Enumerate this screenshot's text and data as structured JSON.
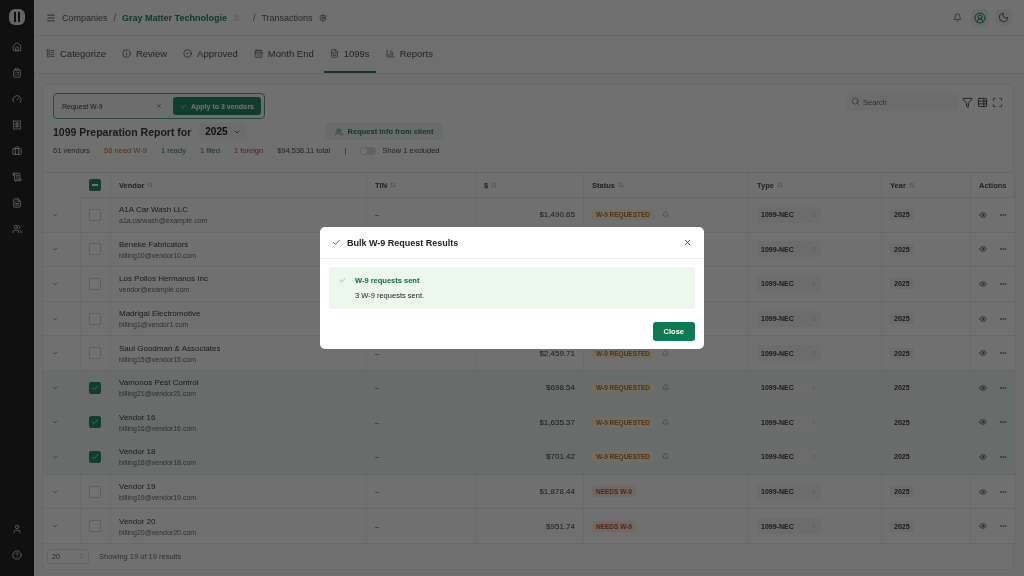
{
  "breadcrumb": {
    "root": "Companies",
    "separator": "/",
    "company": "Gray Matter Technologie",
    "separator_2": "/",
    "page": "Transactions"
  },
  "tabs": [
    {
      "label": "Categorize",
      "selected": false
    },
    {
      "label": "Review",
      "selected": false
    },
    {
      "label": "Approved",
      "selected": false
    },
    {
      "label": "Month End",
      "selected": false
    },
    {
      "label": "1099s",
      "selected": true
    },
    {
      "label": "Reports",
      "selected": false
    }
  ],
  "bulk_action": {
    "value": "Request W-9",
    "button": "Apply to 3 vendors"
  },
  "search": {
    "placeholder": "Search"
  },
  "report": {
    "title": "1099 Preparation Report for",
    "year": "2025",
    "request_button": "Request info from client"
  },
  "stats": [
    {
      "text": "61 vendors",
      "kind": "neutral"
    },
    {
      "text": "58 need W-9",
      "kind": "warning"
    },
    {
      "text": "1 ready",
      "kind": "success"
    },
    {
      "text": "1 filed",
      "kind": "success"
    },
    {
      "text": "1 foreign",
      "kind": "danger"
    },
    {
      "text": "$94,536.11 total",
      "kind": "neutral"
    }
  ],
  "separator": "|",
  "excluded_toggle": {
    "label": "Show 1 excluded",
    "on": false
  },
  "table": {
    "select_all": {
      "indeterminate": true
    },
    "columns": [
      "Vendor",
      "TIN",
      "$",
      "Status",
      "Type",
      "Year",
      "Actions"
    ],
    "rows": [
      {
        "name": "A1A Car Wash LLC",
        "email": "a1a.carwash@example.com",
        "checked": false,
        "tin": "–",
        "amount": "$1,490.65",
        "status": {
          "label": "W-9 REQUESTED",
          "kind": "requested"
        },
        "type": "1099-NEC",
        "year": "2025"
      },
      {
        "name": "Beneke Fabricators",
        "email": "billing10@vendor10.com",
        "checked": false,
        "type": "1099-NEC",
        "year": "2025"
      },
      {
        "name": "Los Pollos Hermanos Inc",
        "email": "vendor@example.com",
        "checked": false,
        "type": "1099-NEC",
        "year": "2025"
      },
      {
        "name": "Madrigal Electromotive",
        "email": "billing1@vendor1.com",
        "checked": false,
        "type": "1099-NEC",
        "year": "2025"
      },
      {
        "name": "Saul Goodman & Associates",
        "email": "billing15@vendor15.com",
        "checked": false,
        "tin": "–",
        "amount": "$2,459.71",
        "status": {
          "label": "W-9 REQUESTED",
          "kind": "requested"
        },
        "type": "1099-NEC",
        "year": "2025"
      },
      {
        "name": "Vamonos Pest Control",
        "email": "billing21@vendor21.com",
        "checked": true,
        "tin": "–",
        "amount": "$698.54",
        "status": {
          "label": "W-9 REQUESTED",
          "kind": "requested"
        },
        "type": "1099-NEC",
        "year": "2025"
      },
      {
        "name": "Vendor 16",
        "email": "billing16@vendor16.com",
        "checked": true,
        "tin": "–",
        "amount": "$1,635.37",
        "status": {
          "label": "W-9 REQUESTED",
          "kind": "requested"
        },
        "type": "1099-NEC",
        "year": "2025"
      },
      {
        "name": "Vendor 18",
        "email": "billing18@vendor18.com",
        "checked": true,
        "tin": "–",
        "amount": "$701.42",
        "status": {
          "label": "W-9 REQUESTED",
          "kind": "requested"
        },
        "type": "1099-NEC",
        "year": "2025"
      },
      {
        "name": "Vendor 19",
        "email": "billing19@vendor19.com",
        "checked": false,
        "tin": "–",
        "amount": "$1,878.44",
        "status": {
          "label": "NEEDS W-9",
          "kind": "needs"
        },
        "type": "1099-NEC",
        "year": "2025"
      },
      {
        "name": "Vendor 20",
        "email": "billing20@vendor20.com",
        "checked": false,
        "tin": "–",
        "amount": "$951.74",
        "status": {
          "label": "NEEDS W-9",
          "kind": "needs"
        },
        "type": "1099-NEC",
        "year": "2025"
      }
    ]
  },
  "pagination": {
    "page_size": "20",
    "summary": "Showing 19 of 19 results"
  },
  "modal": {
    "title": "Bulk W-9 Request Results",
    "alert_title": "W-9 requests sent",
    "alert_message": "3 W-9 requests sent.",
    "button": "Close"
  }
}
